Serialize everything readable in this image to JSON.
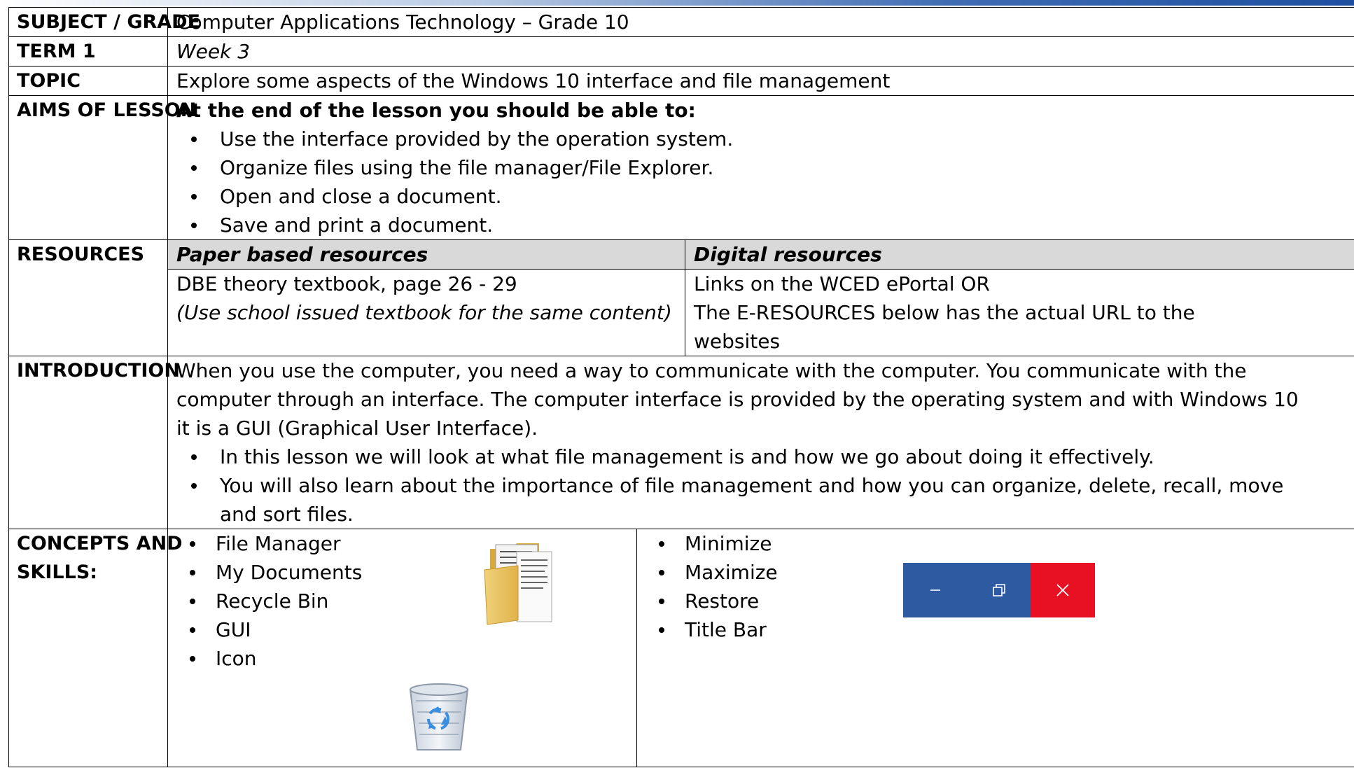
{
  "rows": {
    "subject": {
      "label": "SUBJECT / GRADE",
      "value": "Computer Applications Technology – Grade 10"
    },
    "term": {
      "label": "TERM 1",
      "value": "Week 3"
    },
    "topic": {
      "label": "TOPIC",
      "value": "Explore some aspects of the Windows 10 interface and file management"
    },
    "aims": {
      "label": "AIMS OF LESSON",
      "intro": "At the end of the lesson you should be able to:",
      "items": [
        "Use the interface provided by the operation system.",
        "Organize files using the file manager/File Explorer.",
        "Open and close a document.",
        "Save and print a document."
      ]
    },
    "resources": {
      "label": "RESOURCES",
      "paper_heading": "Paper based resources",
      "digital_heading": "Digital resources",
      "paper_line1": "DBE theory textbook, page 26 - 29",
      "paper_line2": "(Use school issued textbook for the same content)",
      "digital_line1": "Links on the WCED ePortal OR",
      "digital_line2": "The E-RESOURCES below has the actual URL to the",
      "digital_line3": "websites"
    },
    "introduction": {
      "label": "INTRODUCTION",
      "line1": "When you use the computer, you need a way to communicate with the computer. You communicate with the",
      "line2": "computer through an interface. The computer interface is provided by the operating system and with Windows 10",
      "line3": "it is a GUI (Graphical User Interface).",
      "bullet1": "In this lesson we will look at what file management is and how we go about doing it effectively.",
      "bullet2_line1": "You will also learn about the importance of file management and how you can organize, delete, recall, move",
      "bullet2_line2": "and sort files."
    },
    "concepts": {
      "label_line1": "CONCEPTS AND",
      "label_line2": "SKILLS:",
      "left_items": [
        "File Manager",
        "My Documents",
        "Recycle Bin",
        "GUI",
        "Icon"
      ],
      "right_items": [
        "Minimize",
        "Maximize",
        "Restore",
        "Title Bar"
      ]
    }
  },
  "icons": {
    "folder": "folder-documents-icon",
    "recycle_bin": "recycle-bin-icon",
    "minimize": "minimize-icon",
    "restore": "restore-icon",
    "close": "close-icon"
  },
  "colors": {
    "window_controls_bg": "#2d5aa0",
    "close_button_bg": "#e81123",
    "resource_heading_bg": "#d9d9d9"
  }
}
